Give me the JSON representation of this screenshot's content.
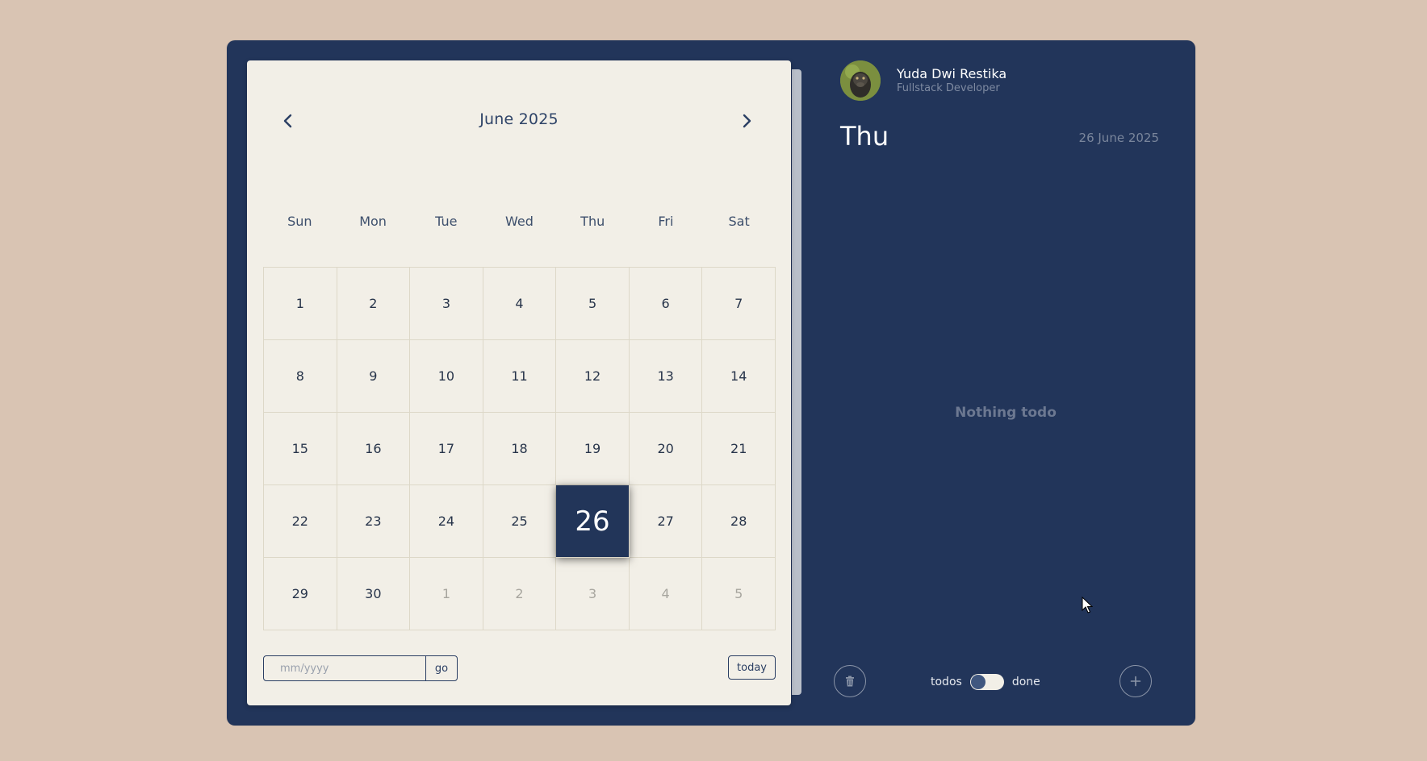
{
  "calendar": {
    "month_title": "June 2025",
    "prev_icon": "chevron-left-icon",
    "next_icon": "chevron-right-icon",
    "weekdays": [
      "Sun",
      "Mon",
      "Tue",
      "Wed",
      "Thu",
      "Fri",
      "Sat"
    ],
    "days": [
      {
        "label": "1"
      },
      {
        "label": "2"
      },
      {
        "label": "3"
      },
      {
        "label": "4"
      },
      {
        "label": "5"
      },
      {
        "label": "6"
      },
      {
        "label": "7"
      },
      {
        "label": "8"
      },
      {
        "label": "9"
      },
      {
        "label": "10"
      },
      {
        "label": "11"
      },
      {
        "label": "12"
      },
      {
        "label": "13"
      },
      {
        "label": "14"
      },
      {
        "label": "15"
      },
      {
        "label": "16"
      },
      {
        "label": "17"
      },
      {
        "label": "18"
      },
      {
        "label": "19"
      },
      {
        "label": "20"
      },
      {
        "label": "21"
      },
      {
        "label": "22"
      },
      {
        "label": "23"
      },
      {
        "label": "24"
      },
      {
        "label": "25"
      },
      {
        "label": "26",
        "selected": true
      },
      {
        "label": "27"
      },
      {
        "label": "28"
      },
      {
        "label": "29"
      },
      {
        "label": "30"
      },
      {
        "label": "1",
        "muted": true
      },
      {
        "label": "2",
        "muted": true
      },
      {
        "label": "3",
        "muted": true
      },
      {
        "label": "4",
        "muted": true
      },
      {
        "label": "5",
        "muted": true
      }
    ],
    "date_input_placeholder": "mm/yyyy",
    "date_input_value": "",
    "go_label": "go",
    "today_label": "today"
  },
  "panel": {
    "user_name": "Yuda Dwi Restika",
    "user_role": "Fullstack Developer",
    "day_name": "Thu",
    "full_date": "26 June 2025",
    "empty_message": "Nothing todo",
    "toggle_left_label": "todos",
    "toggle_right_label": "done",
    "delete_icon": "trash-icon",
    "add_icon": "plus-icon"
  },
  "colors": {
    "background": "#d9c4b3",
    "app_bg": "#22355a",
    "calendar_bg": "#f2efe7",
    "selected_day": "#223559"
  }
}
